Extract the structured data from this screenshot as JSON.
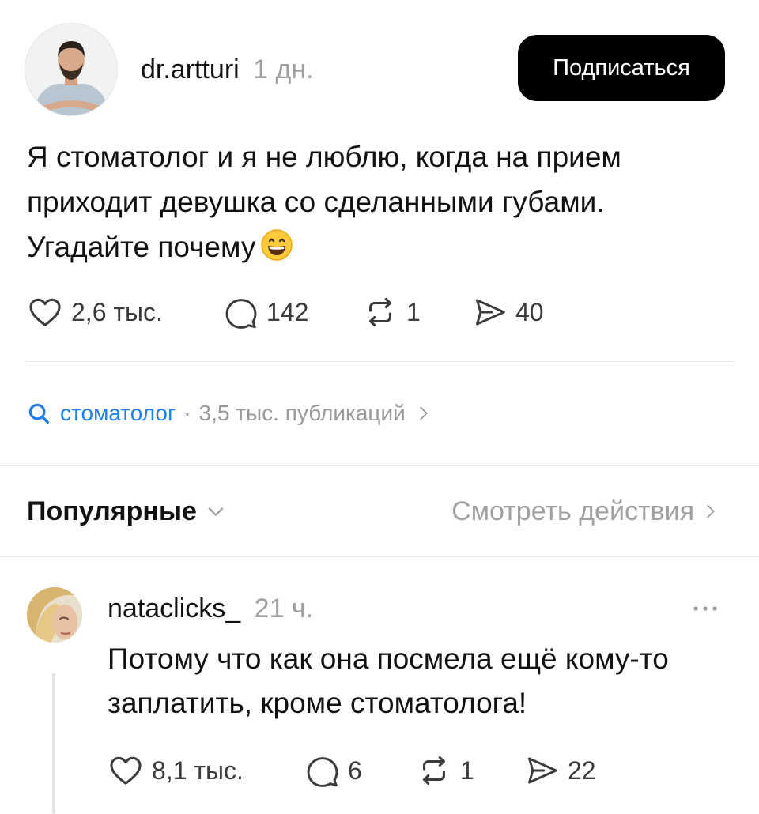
{
  "post": {
    "username": "dr.artturi",
    "time": "1 дн.",
    "follow_label": "Подписаться",
    "text_lines": [
      "Я стоматолог и я не люблю, когда на прием",
      "приходит девушка со сделанными губами.",
      "Угадайте почему"
    ],
    "emoji": "grinning-face-with-smiling-eyes",
    "likes": "2,6 тыс.",
    "comments": "142",
    "reposts": "1",
    "shares": "40"
  },
  "topic": {
    "name": "стоматолог",
    "separator": "·",
    "count": "3,5 тыс. публикаций"
  },
  "filter": {
    "sort_label": "Популярные",
    "activity_label": "Смотреть действия"
  },
  "reply": {
    "username": "nataclicks_",
    "time": "21 ч.",
    "text_lines": [
      "Потому что как она посмела ещё кому-то",
      "заплатить, кроме стоматолога!"
    ],
    "likes": "8,1 тыс.",
    "comments": "6",
    "reposts": "1",
    "shares": "22"
  },
  "icons": {
    "like": "heart-outline-icon",
    "comment": "speech-bubble-icon",
    "repost": "repost-arrows-icon",
    "share": "paper-plane-icon",
    "search": "search-icon",
    "chevron_right": "chevron-right-icon",
    "chevron_down": "chevron-down-icon",
    "more": "more-horizontal-icon"
  },
  "colors": {
    "follow_button_bg": "#000000",
    "topic_link": "#1f7ff0",
    "muted_text": "#a0a0a0",
    "icon_stroke": "#3b3b3b"
  }
}
